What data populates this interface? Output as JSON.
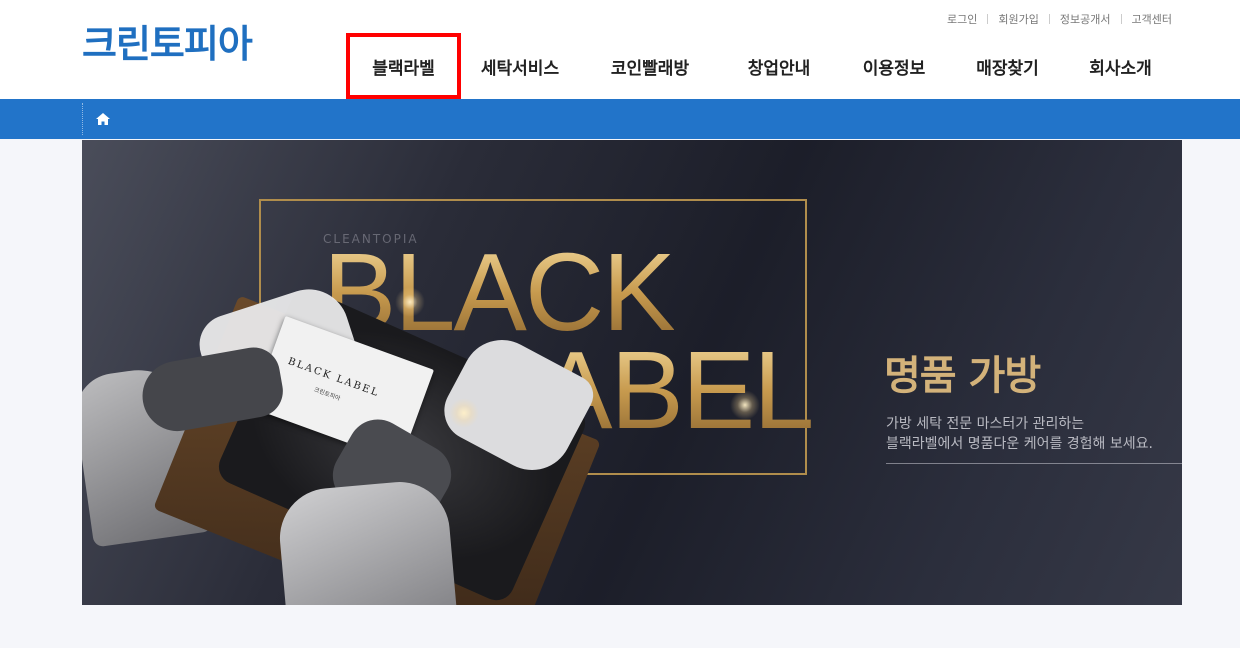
{
  "logo": {
    "text": "크린토피아"
  },
  "util_links": [
    {
      "label": "로그인"
    },
    {
      "label": "회원가입"
    },
    {
      "label": "정보공개서"
    },
    {
      "label": "고객센터"
    }
  ],
  "gnb": [
    {
      "label": "블랙라벨",
      "active": true
    },
    {
      "label": "세탁서비스"
    },
    {
      "label": "코인빨래방"
    },
    {
      "label": "창업안내"
    },
    {
      "label": "이용정보"
    },
    {
      "label": "매장찾기"
    },
    {
      "label": "회사소개"
    }
  ],
  "subbar": {
    "home_icon": "home-icon",
    "color": "#2274c9"
  },
  "banner": {
    "brand": "CLEANTOPIA",
    "headline_line1": "BLACK",
    "headline_line2": "LABEL",
    "card_title": "BLACK LABEL",
    "card_sub": "크린토피아",
    "title": "명품 가방",
    "desc_line1": "가방 세탁 전문 마스터가 관리하는",
    "desc_line2": "블랙라벨에서 명품다운 케어를 경험해 보세요."
  },
  "colors": {
    "accent": "#2274c9",
    "gold": "#d3b27a",
    "highlight": "#ff0000"
  }
}
